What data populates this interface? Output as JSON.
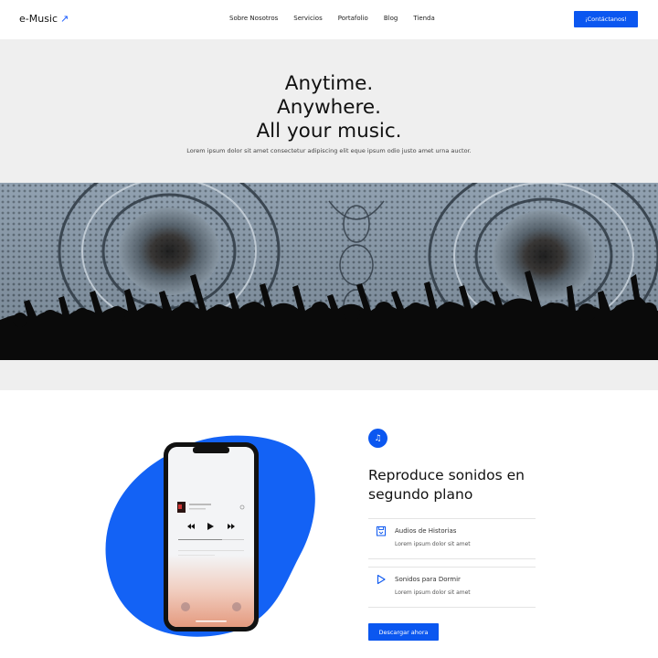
{
  "header": {
    "logo": "e-Music",
    "nav": [
      "Sobre Nosotros",
      "Servicios",
      "Portafolio",
      "Blog",
      "Tienda"
    ],
    "contact_label": "¡Contáctanos!"
  },
  "hero": {
    "title_lines": [
      "Anytime.",
      "Anywhere.",
      "All your music."
    ],
    "subtitle": "Lorem ipsum dolor sit amet consectetur adipiscing elit eque ipsum odio justo amet urna auctor."
  },
  "feature": {
    "badge_icon": "music-note-icon",
    "title": "Reproduce sonidos en segundo plano",
    "items": [
      {
        "icon": "bookmark-save-icon",
        "name": "Audios de Historias",
        "desc": "Lorem ipsum dolor sit amet"
      },
      {
        "icon": "play-outline-icon",
        "name": "Sonidos para Dormir",
        "desc": "Lorem ipsum dolor sit amet"
      }
    ],
    "download_label": "Descargar ahora"
  },
  "colors": {
    "accent": "#0b57f0",
    "hero_bg": "#efefef",
    "text": "#111111"
  }
}
